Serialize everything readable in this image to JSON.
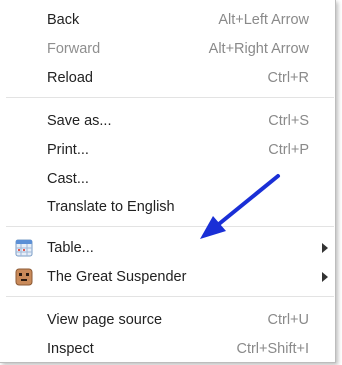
{
  "menu": {
    "group1": [
      {
        "label": "Back",
        "shortcut": "Alt+Left Arrow",
        "enabled": true
      },
      {
        "label": "Forward",
        "shortcut": "Alt+Right Arrow",
        "enabled": false
      },
      {
        "label": "Reload",
        "shortcut": "Ctrl+R",
        "enabled": true
      }
    ],
    "group2": [
      {
        "label": "Save as...",
        "shortcut": "Ctrl+S"
      },
      {
        "label": "Print...",
        "shortcut": "Ctrl+P"
      },
      {
        "label": "Cast..."
      },
      {
        "label": "Translate to English"
      }
    ],
    "group3": [
      {
        "label": "Table...",
        "icon": "table-extension-icon",
        "submenu": true
      },
      {
        "label": "The Great Suspender",
        "icon": "great-suspender-icon",
        "submenu": true
      }
    ],
    "group4": [
      {
        "label": "View page source",
        "shortcut": "Ctrl+U"
      },
      {
        "label": "Inspect",
        "shortcut": "Ctrl+Shift+I"
      }
    ]
  },
  "colors": {
    "annotation_arrow": "#1a2fd6",
    "disabled_text": "#8f8f8f",
    "shortcut_text": "#8a8a8a"
  },
  "icons": {
    "annotation": "blue-arrow-icon",
    "submenu": "chevron-right-icon"
  }
}
